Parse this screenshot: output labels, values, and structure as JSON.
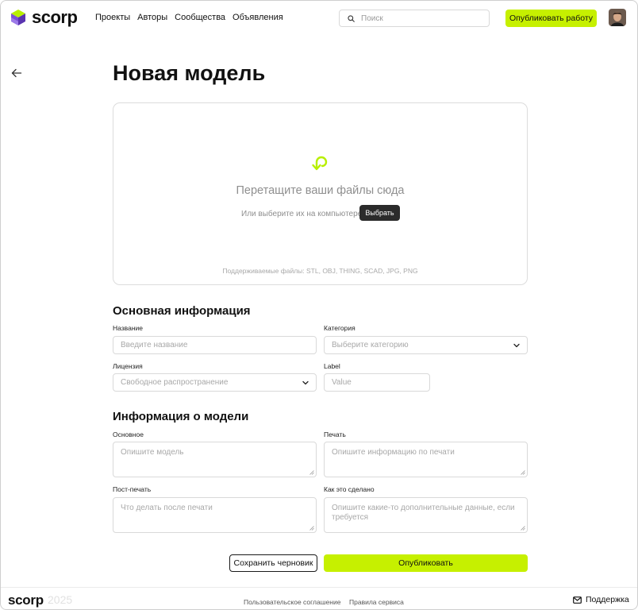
{
  "header": {
    "logo_text": "scorp",
    "nav": [
      "Проекты",
      "Авторы",
      "Сообщества",
      "Объявления"
    ],
    "search_placeholder": "Поиск",
    "publish_work_label": "Опубликовать работу"
  },
  "page": {
    "title": "Новая модель"
  },
  "dropzone": {
    "title": "Перетащите ваши файлы сюда",
    "subtitle": "Или выберите их на компьютере",
    "choose_label": "Выбрать",
    "formats": "Поддерживаемые файлы: STL, OBJ, THING, SCAD, JPG, PNG"
  },
  "basic_info": {
    "title": "Основная информация",
    "name_label": "Название",
    "name_placeholder": "Введите название",
    "category_label": "Категория",
    "category_placeholder": "Выберите категорию",
    "license_label": "Лицензия",
    "license_value": "Свободное распространение",
    "label_label": "Label",
    "label_placeholder": "Value"
  },
  "model_info": {
    "title": "Информация о модели",
    "main_label": "Основное",
    "main_placeholder": "Опишите модель",
    "print_label": "Печать",
    "print_placeholder": "Опишите информацию по печати",
    "post_label": "Пост-печать",
    "post_placeholder": "Что делать после печати",
    "how_label": "Как это сделано",
    "how_placeholder": "Опишите какие-то дополнительные данные, если требуется"
  },
  "actions": {
    "save_draft_label": "Сохранить черновик",
    "publish_label": "Опубликовать"
  },
  "footer": {
    "logo_text": "scorp",
    "year": "2025",
    "agreement_link": "Пользовательское соглашение",
    "rules_link": "Правила сервиса",
    "support_label": "Поддержка"
  },
  "colors": {
    "accent": "#c6f000",
    "dark_button": "#2b2b2b",
    "logo_purple": "#7b4fd6",
    "logo_green": "#b8ef00"
  }
}
